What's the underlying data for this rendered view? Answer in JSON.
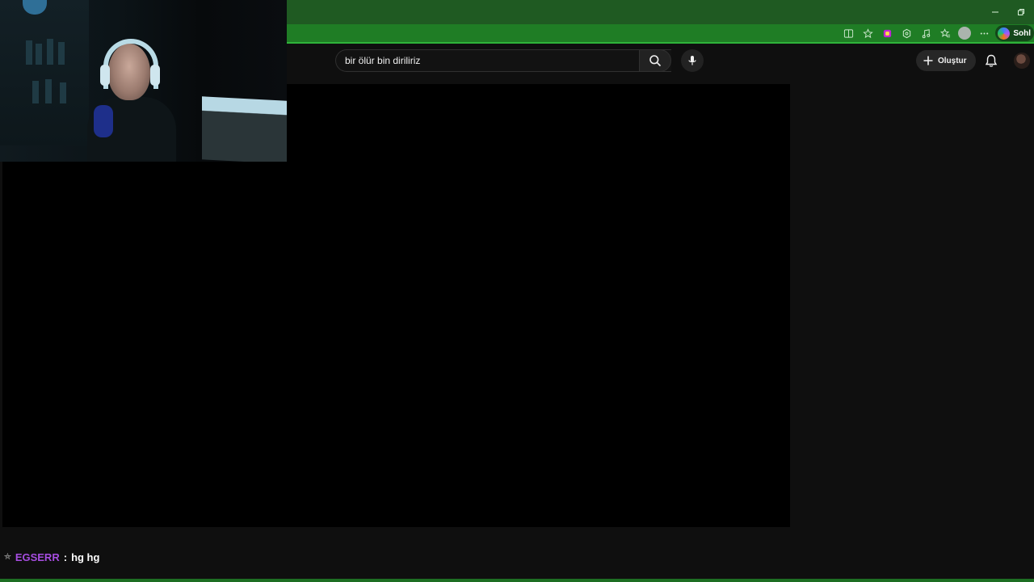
{
  "browser": {
    "theme_color": "#1f7d25",
    "window_controls": [
      "minimize",
      "restore"
    ],
    "toolbar_icons": [
      "split-screen-icon",
      "favorite-star-icon",
      "extension-app-icon",
      "extensions-icon",
      "media-icon",
      "favorites-icon",
      "profile-icon",
      "more-icon"
    ],
    "copilot_label": "Sohl"
  },
  "youtube": {
    "search": {
      "value": "bir ölür bin diriliriz"
    },
    "create_label": "Oluştur"
  },
  "chat": {
    "username": "EGSERR",
    "separator": ":",
    "message": "hg hg",
    "username_color": "#a64de0"
  }
}
